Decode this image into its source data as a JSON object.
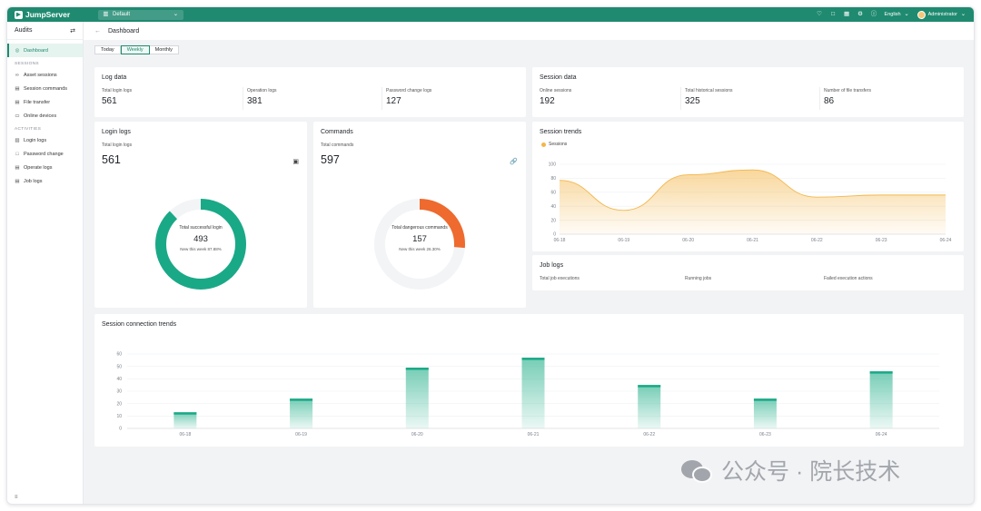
{
  "app": {
    "name": "JumpServer",
    "org": "Default"
  },
  "topbar": {
    "language": "English",
    "user": "Administrator"
  },
  "sidebar": {
    "title": "Audits",
    "items": [
      {
        "label": "Dashboard",
        "icon": "dashboard-icon",
        "active": true
      }
    ],
    "sessions_title": "SESSIONS",
    "sessions": [
      {
        "label": "Asset sessions",
        "icon": "link-icon"
      },
      {
        "label": "Session commands",
        "icon": "terminal-icon"
      },
      {
        "label": "File transfer",
        "icon": "file-transfer-icon"
      },
      {
        "label": "Online devices",
        "icon": "device-icon"
      }
    ],
    "activities_title": "ACTIVITIES",
    "activities": [
      {
        "label": "Login logs",
        "icon": "login-icon"
      },
      {
        "label": "Password change",
        "icon": "lock-icon"
      },
      {
        "label": "Operate logs",
        "icon": "operate-icon"
      },
      {
        "label": "Job logs",
        "icon": "job-icon"
      }
    ]
  },
  "breadcrumb": {
    "title": "Dashboard"
  },
  "tabs": [
    "Today",
    "Weekly",
    "Monthly"
  ],
  "active_tab": "Weekly",
  "log_data": {
    "title": "Log data",
    "stats": [
      {
        "label": "Total login logs",
        "value": "561"
      },
      {
        "label": "Operation logs",
        "value": "381"
      },
      {
        "label": "Password change logs",
        "value": "127"
      }
    ]
  },
  "session_data": {
    "title": "Session data",
    "stats": [
      {
        "label": "Online sessions",
        "value": "192"
      },
      {
        "label": "Total historical sessions",
        "value": "325"
      },
      {
        "label": "Number of file transfers",
        "value": "86"
      }
    ]
  },
  "login_logs": {
    "title": "Login logs",
    "total_label": "Total login logs",
    "total_value": "561",
    "center_label": "Total successful login",
    "center_value": "493",
    "center_note": "New this week 87.88%",
    "fraction": 0.8788,
    "color": "#1aa987"
  },
  "commands": {
    "title": "Commands",
    "total_label": "Total commands",
    "total_value": "597",
    "center_label": "Total dangerous commands",
    "center_value": "157",
    "center_note": "New this week 26.30%",
    "fraction": 0.263,
    "color": "#ee6a2e"
  },
  "session_trends": {
    "title": "Session trends",
    "legend": "Sessions",
    "color": "#f3b64b"
  },
  "job_logs": {
    "title": "Job logs",
    "stats": [
      {
        "label": "Total job executions"
      },
      {
        "label": "Running jobs"
      },
      {
        "label": "Failed execution actions"
      }
    ]
  },
  "connection_trends": {
    "title": "Session connection trends"
  },
  "chart_data": [
    {
      "type": "area",
      "title": "Session trends",
      "x": [
        "06-18",
        "06-19",
        "06-20",
        "06-21",
        "06-22",
        "06-23",
        "06-24"
      ],
      "series": [
        {
          "name": "Sessions",
          "values": [
            77,
            34,
            85,
            92,
            53,
            56,
            56
          ]
        }
      ],
      "ylim": [
        0,
        100
      ],
      "yticks": [
        0,
        20,
        40,
        60,
        80,
        100
      ],
      "grid": true
    },
    {
      "type": "bar",
      "title": "Session connection trends",
      "categories": [
        "06-18",
        "06-19",
        "06-20",
        "06-21",
        "06-22",
        "06-23",
        "06-24"
      ],
      "values": [
        13,
        24,
        49,
        57,
        35,
        24,
        46
      ],
      "ylim": [
        0,
        60
      ],
      "yticks": [
        0,
        10,
        20,
        30,
        40,
        50,
        60
      ],
      "grid": true
    }
  ],
  "watermark": {
    "text": "公众号 · 院长技术"
  }
}
